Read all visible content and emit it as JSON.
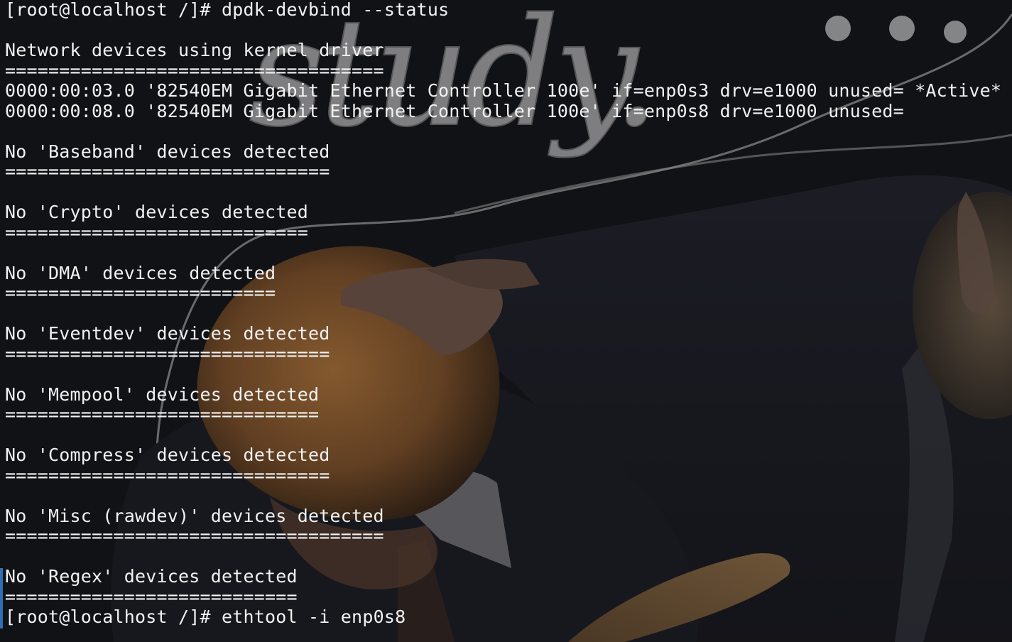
{
  "window": {
    "prompt": "[root@localhost /]#"
  },
  "lines": [
    {
      "kind": "command",
      "prompt": "[root@localhost /]#",
      "command": "dpdk-devbind --status"
    },
    {
      "kind": "blank",
      "text": ""
    },
    {
      "kind": "heading",
      "text": "Network devices using kernel driver"
    },
    {
      "kind": "rule",
      "text": "==================================="
    },
    {
      "kind": "device",
      "text": "0000:00:03.0 '82540EM Gigabit Ethernet Controller 100e' if=enp0s3 drv=e1000 unused= *Active*"
    },
    {
      "kind": "device",
      "text": "0000:00:08.0 '82540EM Gigabit Ethernet Controller 100e' if=enp0s8 drv=e1000 unused="
    },
    {
      "kind": "blank",
      "text": ""
    },
    {
      "kind": "heading",
      "text": "No 'Baseband' devices detected"
    },
    {
      "kind": "rule",
      "text": "=============================="
    },
    {
      "kind": "blank",
      "text": ""
    },
    {
      "kind": "heading",
      "text": "No 'Crypto' devices detected"
    },
    {
      "kind": "rule",
      "text": "============================"
    },
    {
      "kind": "blank",
      "text": ""
    },
    {
      "kind": "heading",
      "text": "No 'DMA' devices detected"
    },
    {
      "kind": "rule",
      "text": "========================="
    },
    {
      "kind": "blank",
      "text": ""
    },
    {
      "kind": "heading",
      "text": "No 'Eventdev' devices detected"
    },
    {
      "kind": "rule",
      "text": "=============================="
    },
    {
      "kind": "blank",
      "text": ""
    },
    {
      "kind": "heading",
      "text": "No 'Mempool' devices detected"
    },
    {
      "kind": "rule",
      "text": "============================="
    },
    {
      "kind": "blank",
      "text": ""
    },
    {
      "kind": "heading",
      "text": "No 'Compress' devices detected"
    },
    {
      "kind": "rule",
      "text": "=============================="
    },
    {
      "kind": "blank",
      "text": ""
    },
    {
      "kind": "heading",
      "text": "No 'Misc (rawdev)' devices detected"
    },
    {
      "kind": "rule",
      "text": "==================================="
    },
    {
      "kind": "blank",
      "text": ""
    },
    {
      "kind": "heading",
      "text": "No 'Regex' devices detected"
    },
    {
      "kind": "rule",
      "text": "==========================="
    },
    {
      "kind": "command",
      "prompt": "[root@localhost /]#",
      "command": "ethtool -i enp0s8"
    }
  ],
  "wallpaper": {
    "handwriting": "study...",
    "colors": {
      "background": "#121316",
      "hair": "#b8763e",
      "robe": "#1a1c24",
      "skin": "#8a6a5c",
      "chalk": "#d8d8d8",
      "accent_bar": "#2f6fb2",
      "text": "#f2f2f2"
    }
  }
}
